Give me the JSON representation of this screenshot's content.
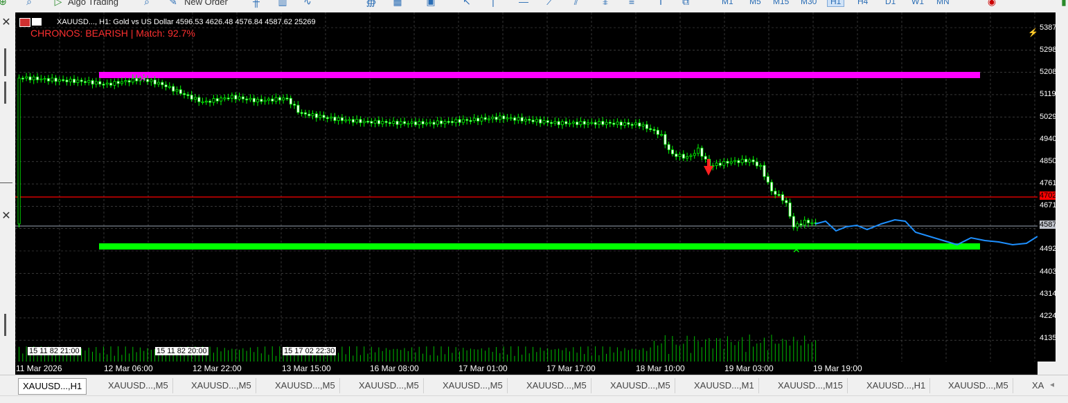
{
  "toolbar": {
    "algo_trading_label": "Algo Trading",
    "new_order_label": "New Order",
    "timeframes": [
      "M1",
      "M5",
      "M15",
      "M30",
      "H1",
      "H4",
      "D1",
      "W1",
      "MN"
    ],
    "active_timeframe": "H1"
  },
  "chart": {
    "header": "XAUUSD..., H1:  Gold vs US Dollar  4596.53 4626.48 4576.84 4587.62  25269",
    "chronos_label": "CHRONOS: BEARISH | Match: 92.7%",
    "price_labels": [
      "5387.45",
      "5298.00",
      "5208.55",
      "5119.10",
      "5029.65",
      "4940.20",
      "4850.75",
      "4761.30",
      "4671.85",
      "4582.40",
      "4492.95",
      "4403.50",
      "4314.05",
      "4224.60",
      "4135.15"
    ],
    "current_price": "4587.62",
    "red_line_price": "4702.00",
    "time_labels": [
      "11 Mar 2026",
      "12 Mar 06:00",
      "12 Mar 22:00",
      "13 Mar 15:00",
      "16 Mar 08:00",
      "17 Mar 01:00",
      "17 Mar 17:00",
      "18 Mar 10:00",
      "19 Mar 03:00",
      "19 Mar 19:00"
    ],
    "vline_labels": [
      "15 11 82 21:00",
      "15 11 82 20:00",
      "15 17 02 22:30"
    ],
    "colors": {
      "background": "#000000",
      "candles": "#00ff00",
      "resistance": "#ff00ff",
      "support": "#00ff00",
      "forecast": "#1e90ff",
      "red_line": "#ff0000"
    }
  },
  "tabs": [
    "XAUUSD...,H1",
    "XAUUSD...,M5",
    "XAUUSD...,M5",
    "XAUUSD...,M5",
    "XAUUSD...,M5",
    "XAUUSD...,M5",
    "XAUUSD...,M5",
    "XAUUSD...,M5",
    "XAUUSD...,M1",
    "XAUUSD...,M15",
    "XAUUSD...,H1",
    "XAUUSD...,M5",
    "XA"
  ],
  "active_tab": 0
}
